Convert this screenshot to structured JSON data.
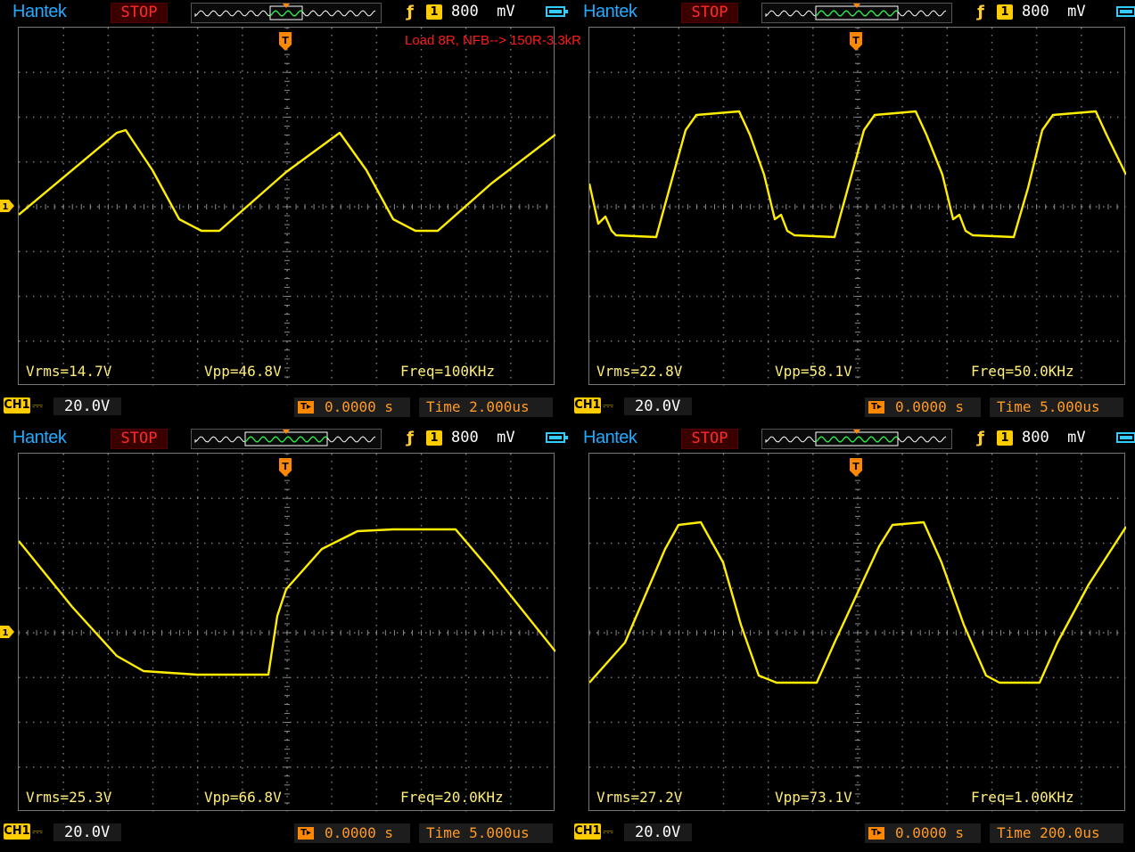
{
  "annotation": "Load 8R, NFB--> 150R-3.3kR",
  "colors": {
    "trace": "#ffee00",
    "grid": "#7a7a7a",
    "trigger": "#ff8800",
    "brand": "#22aaff",
    "stop": "#ff2a2a"
  },
  "icons": {
    "trigger_edge": "rising-edge-icon",
    "battery": "battery-icon",
    "trigger_marker": "trigger-marker-icon",
    "channel_marker": "channel-marker-icon"
  },
  "panels": [
    {
      "brand": "Hantek",
      "status": "STOP",
      "trigger": {
        "edge_symbol": "ƒ",
        "channel": "1",
        "level": "800  mV"
      },
      "ch_marker": "1",
      "trig_marker": "T",
      "measurements": {
        "vrms": "Vrms=14.7V",
        "vpp": "Vpp=46.8V",
        "freq": "Freq=100KHz"
      },
      "channel": {
        "label": "CH1",
        "coupling": "⎓",
        "volts_div": "20.0V"
      },
      "trigger_position": "0.0000 s",
      "time_div": "Time 2.000us",
      "waveform": "triangle"
    },
    {
      "brand": "Hantek",
      "status": "STOP",
      "trigger": {
        "edge_symbol": "ƒ",
        "channel": "1",
        "level": "800  mV"
      },
      "ch_marker": "1",
      "trig_marker": "T",
      "measurements": {
        "vrms": "Vrms=22.8V",
        "vpp": "Vpp=58.1V",
        "freq": "Freq=50.0KHz"
      },
      "channel": {
        "label": "CH1",
        "coupling": "⎓",
        "volts_div": "20.0V"
      },
      "trigger_position": "0.0000 s",
      "time_div": "Time 5.000us",
      "waveform": "clipped-ringing"
    },
    {
      "brand": "Hantek",
      "status": "STOP",
      "trigger": {
        "edge_symbol": "ƒ",
        "channel": "1",
        "level": "800  mV"
      },
      "ch_marker": "1",
      "trig_marker": "T",
      "measurements": {
        "vrms": "Vrms=25.3V",
        "vpp": "Vpp=66.8V",
        "freq": "Freq=20.0KHz"
      },
      "channel": {
        "label": "CH1",
        "coupling": "⎓",
        "volts_div": "20.0V"
      },
      "trigger_position": "0.0000 s",
      "time_div": "Time 5.000us",
      "waveform": "slewed-clipped"
    },
    {
      "brand": "Hantek",
      "status": "STOP",
      "trigger": {
        "edge_symbol": "ƒ",
        "channel": "1",
        "level": "800  mV"
      },
      "ch_marker": "1",
      "trig_marker": "T",
      "measurements": {
        "vrms": "Vrms=27.2V",
        "vpp": "Vpp=73.1V",
        "freq": "Freq=1.00KHz"
      },
      "channel": {
        "label": "CH1",
        "coupling": "⎓",
        "volts_div": "20.0V"
      },
      "trigger_position": "0.0000 s",
      "time_div": "Time 200.0us",
      "waveform": "clipped-sine"
    }
  ]
}
